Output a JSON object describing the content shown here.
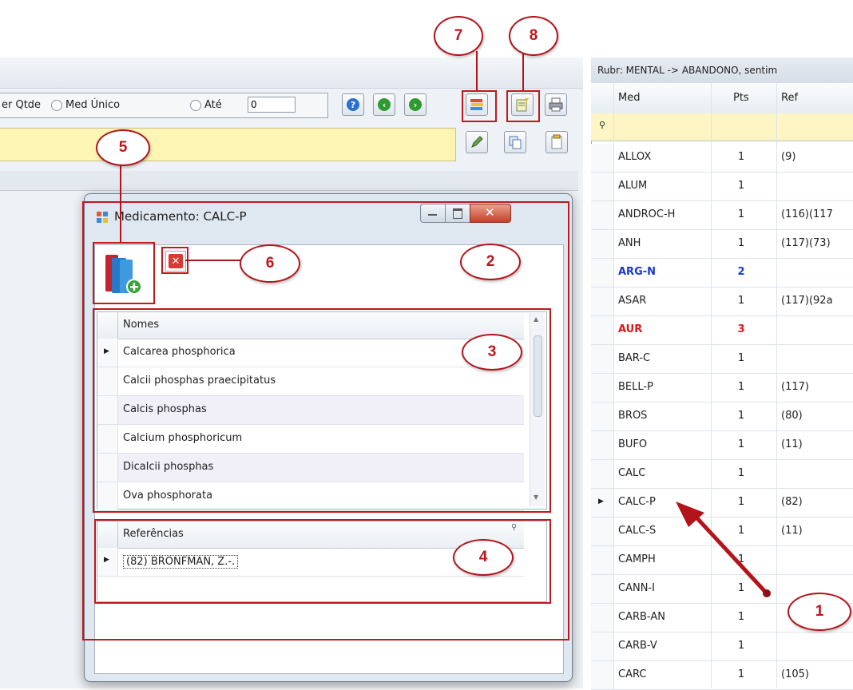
{
  "left_panel": {
    "options": {
      "qtde_label": "er Qtde",
      "med_unico_label": "Med Único",
      "ate_label": "Até",
      "ate_value": "0"
    }
  },
  "right_grid": {
    "title": "Rubr: MENTAL -> ABANDONO, sentim",
    "columns": [
      "Med",
      "Pts",
      "Ref"
    ],
    "rows": [
      {
        "med": "ALLOX",
        "pts": "1",
        "ref": "(9)",
        "color": "#1e1e1e"
      },
      {
        "med": "ALUM",
        "pts": "1",
        "ref": "",
        "color": "#1e1e1e"
      },
      {
        "med": "ANDROC-H",
        "pts": "1",
        "ref": "(116)(117",
        "color": "#1e1e1e"
      },
      {
        "med": "ANH",
        "pts": "1",
        "ref": "(117)(73)",
        "color": "#1e1e1e"
      },
      {
        "med": "ARG-N",
        "pts": "2",
        "ref": "",
        "color": "#1a36d6"
      },
      {
        "med": "ASAR",
        "pts": "1",
        "ref": "(117)(92a",
        "color": "#1e1e1e"
      },
      {
        "med": "AUR",
        "pts": "3",
        "ref": "",
        "color": "#e0141a"
      },
      {
        "med": "BAR-C",
        "pts": "1",
        "ref": "",
        "color": "#1e1e1e"
      },
      {
        "med": "BELL-P",
        "pts": "1",
        "ref": "(117)",
        "color": "#1e1e1e"
      },
      {
        "med": "BROS",
        "pts": "1",
        "ref": "(80)",
        "color": "#1e1e1e"
      },
      {
        "med": "BUFO",
        "pts": "1",
        "ref": "(11)",
        "color": "#1e1e1e"
      },
      {
        "med": "CALC",
        "pts": "1",
        "ref": "",
        "color": "#1e1e1e"
      },
      {
        "med": "CALC-P",
        "pts": "1",
        "ref": "(82)",
        "color": "#1e1e1e"
      },
      {
        "med": "CALC-S",
        "pts": "1",
        "ref": "(11)",
        "color": "#1e1e1e"
      },
      {
        "med": "CAMPH",
        "pts": "1",
        "ref": "",
        "color": "#1e1e1e"
      },
      {
        "med": "CANN-I",
        "pts": "1",
        "ref": "",
        "color": "#1e1e1e"
      },
      {
        "med": "CARB-AN",
        "pts": "1",
        "ref": "",
        "color": "#1e1e1e"
      },
      {
        "med": "CARB-V",
        "pts": "1",
        "ref": "",
        "color": "#1e1e1e"
      },
      {
        "med": "CARC",
        "pts": "1",
        "ref": "(105)",
        "color": "#1e1e1e"
      }
    ]
  },
  "dialog": {
    "title": "Medicamento: CALC-P",
    "names_header": "Nomes",
    "names": [
      "Calcarea phosphorica",
      "Calcii phosphas praecipitatus",
      "Calcis phosphas",
      "Calcium phosphoricum",
      "Dicalcii phosphas",
      "Ova phosphorata"
    ],
    "refs_header": "Referências",
    "refs": [
      "(82) BRONFMAN, Z.-."
    ]
  },
  "callouts": {
    "c1": "1",
    "c2": "2",
    "c3": "3",
    "c4": "4",
    "c5": "5",
    "c6": "6",
    "c7": "7",
    "c8": "8"
  },
  "colors": {
    "annotation_red": "#b3141a",
    "filter_yellow": "#fdf6c4",
    "med_blue": "#1a36d6",
    "med_red": "#e0141a"
  },
  "icons": [
    "help-icon",
    "prev-icon",
    "next-icon",
    "books-icon",
    "edit-note-icon",
    "printer-icon",
    "pencil-icon",
    "copy-icon",
    "page-icon",
    "add-book-icon",
    "delete-icon",
    "filter-icon",
    "row-pointer-icon",
    "app-icon",
    "minimize-icon",
    "maximize-icon",
    "close-icon"
  ]
}
